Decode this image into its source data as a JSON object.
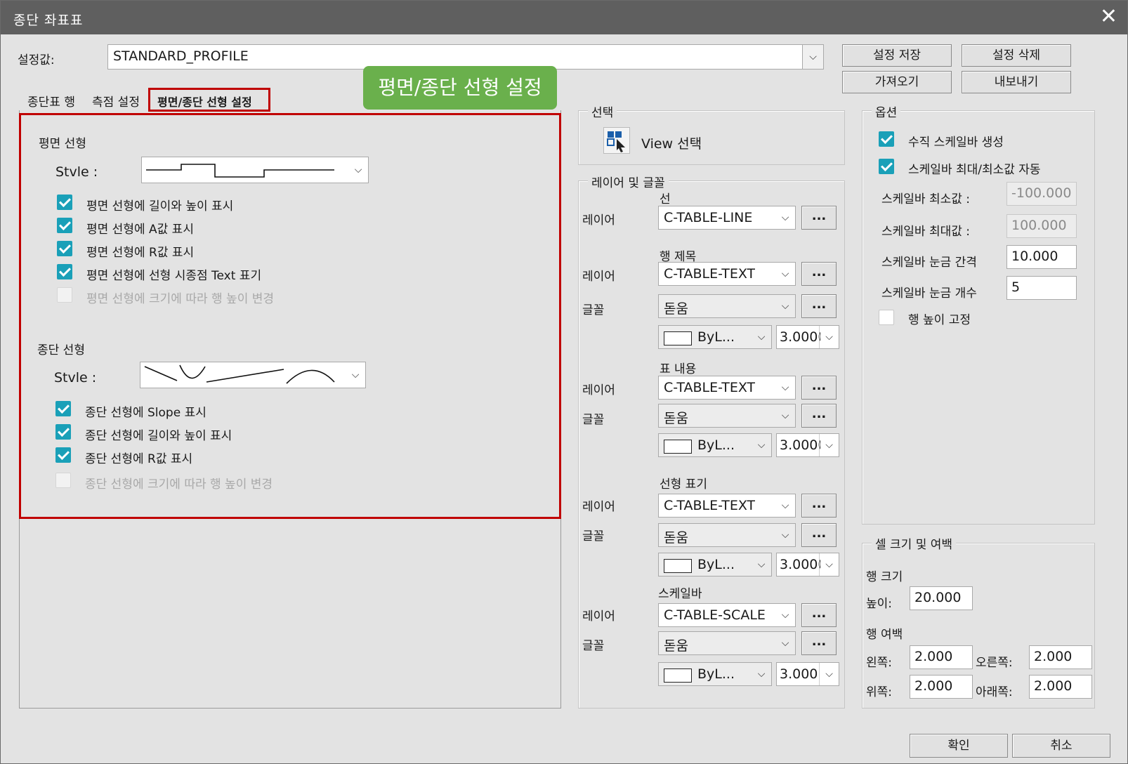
{
  "window": {
    "title": "종단 좌표표",
    "close_glyph": "✕"
  },
  "preset": {
    "label": "설정값:",
    "value": "STANDARD_PROFILE"
  },
  "buttons": {
    "save": "설정 저장",
    "delete": "설정 삭제",
    "import": "가져오기",
    "export": "내보내기",
    "ok": "확인",
    "cancel": "취소"
  },
  "tabs": [
    {
      "label": "종단표 행"
    },
    {
      "label": "측점 설정"
    },
    {
      "label": "평면/종단 선형 설정",
      "active": true
    }
  ],
  "callout": {
    "text": "평면/종단 선형 설정",
    "color": "#6ab04c"
  },
  "highlight_color": "#c00000",
  "plan": {
    "title": "평면 선형",
    "style_label": "Stvle :",
    "checks": [
      {
        "label": "평면 선형에 길이와 높이 표시",
        "checked": true
      },
      {
        "label": "평면 선형에 A값 표시",
        "checked": true
      },
      {
        "label": "평면 선형에 R값 표시",
        "checked": true
      },
      {
        "label": "평면 선형에 선형 시종점 Text 표기",
        "checked": true
      },
      {
        "label": "평면 선형에 크기에 따라 행 높이 변경",
        "checked": false,
        "disabled": true
      }
    ]
  },
  "profile": {
    "title": "종단 선형",
    "style_label": "Stvle :",
    "checks": [
      {
        "label": "종단 선형에 Slope 표시",
        "checked": true
      },
      {
        "label": "종단 선형에 길이와 높이 표시",
        "checked": true
      },
      {
        "label": "종단 선형에 R값 표시",
        "checked": true
      },
      {
        "label": "종단 선형에 크기에 따라 행 높이 변경",
        "checked": false,
        "disabled": true
      }
    ]
  },
  "selection": {
    "title": "선택",
    "view_label": "View 선택"
  },
  "layers": {
    "title": "레이어 및 글꼴",
    "layer_label": "레이어",
    "font_label": "글꼴",
    "dots": "...",
    "line": {
      "heading": "선",
      "layer": "C-TABLE-LINE"
    },
    "row_title": {
      "heading": "행 제목",
      "layer": "C-TABLE-TEXT",
      "font": "돋움",
      "color": "ByL...",
      "size": "3.0000"
    },
    "table_content": {
      "heading": "표 내용",
      "layer": "C-TABLE-TEXT",
      "font": "돋움",
      "color": "ByL...",
      "size": "3.0000"
    },
    "alignment": {
      "heading": "선형 표기",
      "layer": "C-TABLE-TEXT",
      "font": "돋움",
      "color": "ByL...",
      "size": "3.0000"
    },
    "scalebar": {
      "heading": "스케일바",
      "layer": "C-TABLE-SCALE",
      "font": "돋움",
      "color": "ByL...",
      "size": "3.000"
    }
  },
  "options": {
    "title": "옵션",
    "vertical_scalebar": {
      "label": "수직 스케일바 생성",
      "checked": true
    },
    "auto_minmax": {
      "label": "스케일바 최대/최소값 자동",
      "checked": true
    },
    "min": {
      "label": "스케일바 최소값 :",
      "value": "-100.000"
    },
    "max": {
      "label": "스케일바 최대값 :",
      "value": "100.000"
    },
    "interval": {
      "label": "스케일바 눈금 간격",
      "value": "10.000"
    },
    "count": {
      "label": "스케일바 눈금 개수",
      "value": "5"
    },
    "fix_row_height": {
      "label": "행 높이 고정",
      "checked": false
    }
  },
  "cell": {
    "title": "셀 크기 및 여백",
    "row_size": "행 크기",
    "height_label": "높이:",
    "height": "20.000",
    "row_margin": "행 여백",
    "left_label": "왼쪽:",
    "left": "2.000",
    "right_label": "오른쪽:",
    "right": "2.000",
    "top_label": "위쪽:",
    "top": "2.000",
    "bottom_label": "아래쪽:",
    "bottom": "2.000"
  }
}
